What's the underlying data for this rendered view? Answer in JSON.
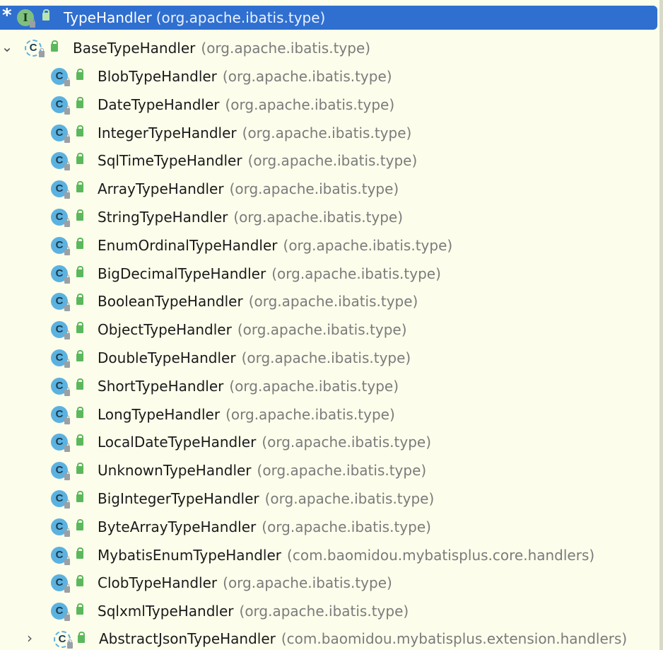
{
  "hierarchy": {
    "root": {
      "name": "TypeHandler",
      "package": "(org.apache.ibatis.type)",
      "marker": "*",
      "icon": "I"
    },
    "base": {
      "name": "BaseTypeHandler",
      "package": "(org.apache.ibatis.type)",
      "icon": "C",
      "expanded": true
    },
    "items": [
      {
        "name": "BlobTypeHandler",
        "package": "(org.apache.ibatis.type)",
        "icon": "C"
      },
      {
        "name": "DateTypeHandler",
        "package": "(org.apache.ibatis.type)",
        "icon": "C"
      },
      {
        "name": "IntegerTypeHandler",
        "package": "(org.apache.ibatis.type)",
        "icon": "C"
      },
      {
        "name": "SqlTimeTypeHandler",
        "package": "(org.apache.ibatis.type)",
        "icon": "C"
      },
      {
        "name": "ArrayTypeHandler",
        "package": "(org.apache.ibatis.type)",
        "icon": "C"
      },
      {
        "name": "StringTypeHandler",
        "package": "(org.apache.ibatis.type)",
        "icon": "C"
      },
      {
        "name": "EnumOrdinalTypeHandler",
        "package": "(org.apache.ibatis.type)",
        "icon": "C"
      },
      {
        "name": "BigDecimalTypeHandler",
        "package": "(org.apache.ibatis.type)",
        "icon": "C"
      },
      {
        "name": "BooleanTypeHandler",
        "package": "(org.apache.ibatis.type)",
        "icon": "C"
      },
      {
        "name": "ObjectTypeHandler",
        "package": "(org.apache.ibatis.type)",
        "icon": "C"
      },
      {
        "name": "DoubleTypeHandler",
        "package": "(org.apache.ibatis.type)",
        "icon": "C"
      },
      {
        "name": "ShortTypeHandler",
        "package": "(org.apache.ibatis.type)",
        "icon": "C"
      },
      {
        "name": "LongTypeHandler",
        "package": "(org.apache.ibatis.type)",
        "icon": "C"
      },
      {
        "name": "LocalDateTypeHandler",
        "package": "(org.apache.ibatis.type)",
        "icon": "C"
      },
      {
        "name": "UnknownTypeHandler",
        "package": "(org.apache.ibatis.type)",
        "icon": "C"
      },
      {
        "name": "BigIntegerTypeHandler",
        "package": "(org.apache.ibatis.type)",
        "icon": "C"
      },
      {
        "name": "ByteArrayTypeHandler",
        "package": "(org.apache.ibatis.type)",
        "icon": "C"
      },
      {
        "name": "MybatisEnumTypeHandler",
        "package": "(com.baomidou.mybatisplus.core.handlers)",
        "icon": "C"
      },
      {
        "name": "ClobTypeHandler",
        "package": "(org.apache.ibatis.type)",
        "icon": "C"
      },
      {
        "name": "SqlxmlTypeHandler",
        "package": "(org.apache.ibatis.type)",
        "icon": "C"
      }
    ],
    "last": {
      "name": "AbstractJsonTypeHandler",
      "package": "(com.baomidou.mybatisplus.extension.handlers)",
      "icon": "C",
      "expanded": false
    }
  },
  "colors": {
    "background": "#fcfdeb",
    "selection": "#2f6fd0",
    "class_icon": "#5bb2e0",
    "interface_icon": "#7fc07f",
    "public_lock": "#5cb85c"
  },
  "icons": {
    "expand": "chevron-down-icon",
    "collapse": "chevron-right-icon",
    "class": "class-icon",
    "abstract_class": "abstract-class-icon",
    "interface": "interface-icon",
    "visibility": "public-access-icon",
    "lock_overlay": "lock-overlay-icon"
  }
}
